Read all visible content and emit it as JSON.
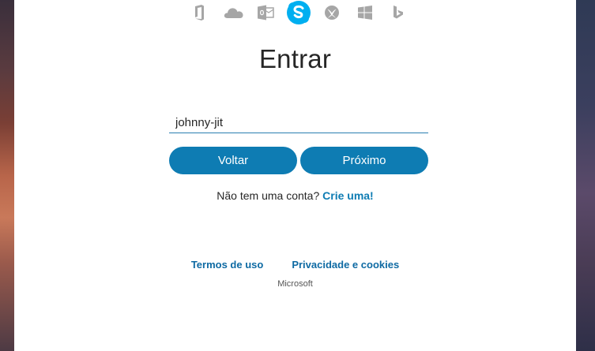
{
  "app_bar": {
    "icons": [
      "office-icon",
      "onedrive-icon",
      "outlook-icon",
      "skype-icon",
      "xbox-icon",
      "windows-icon",
      "bing-icon"
    ],
    "active_icon": "skype-icon",
    "active_color": "#00aff0",
    "inactive_color": "#a6a6a6"
  },
  "form": {
    "title": "Entrar",
    "username_value": "johnny-jit",
    "back_label": "Voltar",
    "next_label": "Próximo",
    "no_account_text": "Não tem uma conta?",
    "create_link": "Crie uma!"
  },
  "footer": {
    "terms_label": "Termos de uso",
    "privacy_label": "Privacidade e cookies",
    "brand": "Microsoft"
  },
  "colors": {
    "accent": "#0e7cb3",
    "text": "#262626"
  }
}
